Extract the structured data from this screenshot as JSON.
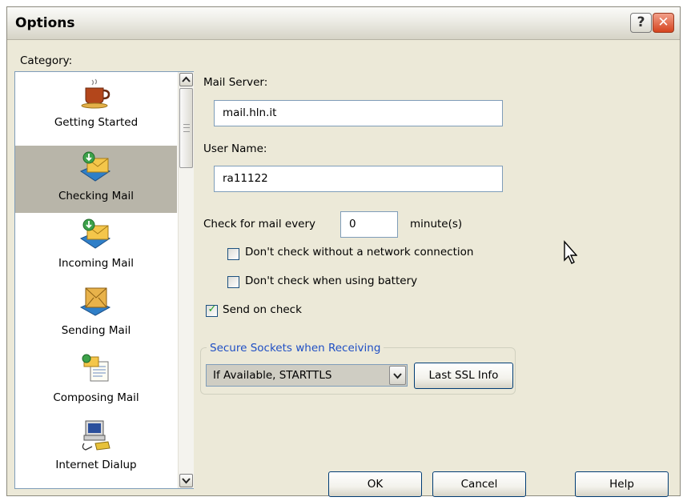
{
  "window": {
    "title": "Options",
    "help_button": "?",
    "close_button": "✕"
  },
  "category": {
    "label": "Category:",
    "items": [
      {
        "label": "Getting Started",
        "icon": "coffee-cup-icon"
      },
      {
        "label": "Checking Mail",
        "icon": "check-mail-icon",
        "selected": true
      },
      {
        "label": "Incoming Mail",
        "icon": "incoming-mail-icon"
      },
      {
        "label": "Sending Mail",
        "icon": "sending-mail-icon"
      },
      {
        "label": "Composing Mail",
        "icon": "composing-mail-icon"
      },
      {
        "label": "Internet Dialup",
        "icon": "dialup-computer-icon"
      }
    ]
  },
  "form": {
    "mail_server_label": "Mail Server:",
    "mail_server_value": "mail.hln.it",
    "user_name_label": "User Name:",
    "user_name_value": "ra11122",
    "check_every_label": "Check for mail every",
    "check_every_value": "0",
    "check_every_unit": "minute(s)",
    "no_network_label": "Don't check without a network connection",
    "no_network_checked": false,
    "battery_label": "Don't check when using battery",
    "battery_checked": false,
    "send_on_check_label": "Send on check",
    "send_on_check_checked": true
  },
  "secure": {
    "legend": "Secure Sockets when Receiving",
    "selected_option": "If Available, STARTTLS",
    "last_ssl_label": "Last SSL Info"
  },
  "buttons": {
    "ok": "OK",
    "cancel": "Cancel",
    "help": "Help"
  },
  "colors": {
    "window_bg": "#ece9d8",
    "selected_item": "#b8b5a9",
    "input_border": "#7f9db9",
    "legend_text": "#1f4fc4",
    "close_button": "#d5431e"
  }
}
